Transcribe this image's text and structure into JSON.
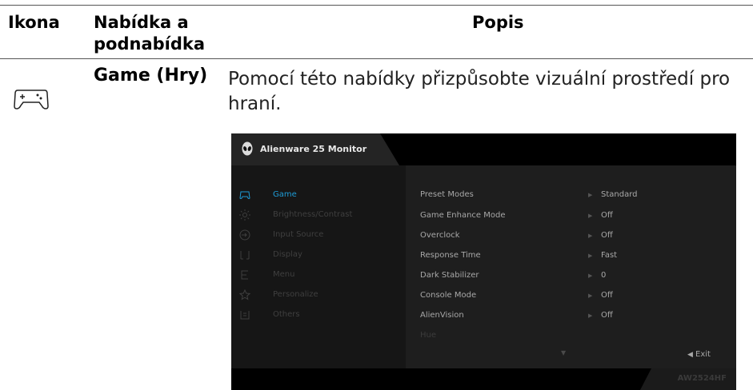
{
  "table": {
    "headers": {
      "icon": "Ikona",
      "menu_line1": "Nabídka a",
      "menu_line2": "podnabídka",
      "description": "Popis"
    },
    "row": {
      "icon": "gamepad-icon",
      "menu": "Game (Hry)",
      "description": "Pomocí této nabídky přizpůsobte vizuální prostředí pro hraní."
    }
  },
  "osd": {
    "title": "Alienware 25 Monitor",
    "model": "AW2524HF",
    "accent_color": "#1e9cd7",
    "menu": [
      {
        "icon": "gamepad-icon",
        "label": "Game",
        "active": true
      },
      {
        "icon": "brightness-icon",
        "label": "Brightness/Contrast",
        "active": false
      },
      {
        "icon": "input-source-icon",
        "label": "Input Source",
        "active": false
      },
      {
        "icon": "display-icon",
        "label": "Display",
        "active": false
      },
      {
        "icon": "menu-icon",
        "label": "Menu",
        "active": false
      },
      {
        "icon": "star-icon",
        "label": "Personalize",
        "active": false
      },
      {
        "icon": "others-icon",
        "label": "Others",
        "active": false
      }
    ],
    "options": [
      {
        "label": "Preset Modes",
        "value": "Standard"
      },
      {
        "label": "Game Enhance Mode",
        "value": "Off"
      },
      {
        "label": "Overclock",
        "value": "Off"
      },
      {
        "label": "Response Time",
        "value": "Fast"
      },
      {
        "label": "Dark Stabilizer",
        "value": "0"
      },
      {
        "label": "Console Mode",
        "value": "Off"
      },
      {
        "label": "AlienVision",
        "value": "Off"
      },
      {
        "label": "Hue",
        "value": ""
      }
    ],
    "exit_label": "Exit"
  }
}
